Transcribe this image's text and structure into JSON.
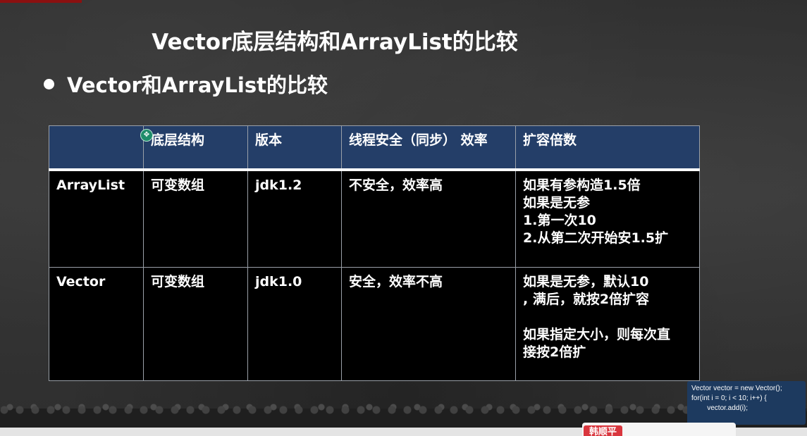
{
  "slide": {
    "title": "Vector底层结构和ArrayList的比较",
    "bullet": "Vector和ArrayList的比较"
  },
  "table": {
    "headers": [
      "",
      "底层结构",
      "版本",
      "线程安全（同步） 效率",
      "扩容倍数"
    ],
    "rows": [
      {
        "name": "ArrayList",
        "structure": "可变数组",
        "version": "jdk1.2",
        "thread_safety": "不安全，效率高",
        "growth": [
          "如果有参构造1.5倍",
          "如果是无参",
          "1.第一次10",
          "2.从第二次开始安1.5扩"
        ]
      },
      {
        "name": "Vector",
        "structure": "可变数组",
        "version": "jdk1.0",
        "thread_safety": "安全，效率不高",
        "growth": [
          "如果是无参，默认10",
          ", 满后，就按2倍扩容",
          "",
          "如果指定大小，则每次直",
          "接按2倍扩"
        ]
      }
    ]
  },
  "cursor_icon": "move-cursor-icon",
  "code_popup": {
    "lines": [
      "Vector vector = new Vector();",
      "for(int i = 0; i < 10; i++) {",
      "        vector.add(i);"
    ]
  },
  "presenter_badge": "韩顺平",
  "colors": {
    "board": "#333333",
    "header_bg": "#243e68",
    "cell_bg": "#000000",
    "popup_bg": "#1d3a5f",
    "badge": "#d9363e"
  }
}
